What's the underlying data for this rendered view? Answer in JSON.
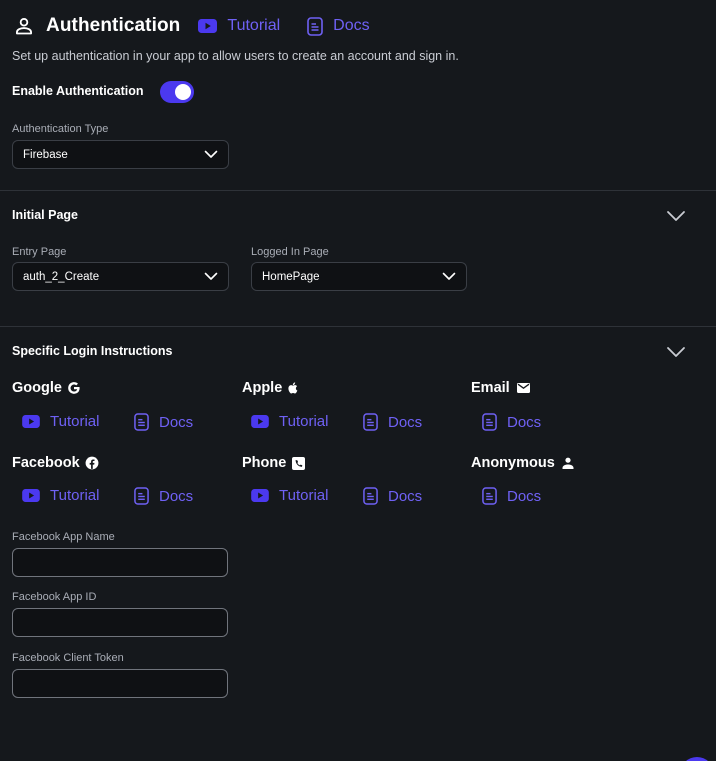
{
  "header": {
    "title": "Authentication",
    "tutorial_label": "Tutorial",
    "docs_label": "Docs",
    "subtitle": "Set up authentication in your app to allow users to create an account and sign in."
  },
  "enable": {
    "label": "Enable Authentication",
    "value": true
  },
  "auth_type": {
    "label": "Authentication Type",
    "value": "Firebase"
  },
  "initial_page": {
    "title": "Initial Page",
    "entry_label": "Entry Page",
    "entry_value": "auth_2_Create",
    "logged_in_label": "Logged In Page",
    "logged_in_value": "HomePage"
  },
  "login_instructions": {
    "title": "Specific Login Instructions",
    "providers": [
      {
        "name": "Google",
        "icon": "google-icon",
        "tutorial": "Tutorial",
        "docs": "Docs"
      },
      {
        "name": "Apple",
        "icon": "apple-icon",
        "tutorial": "Tutorial",
        "docs": "Docs"
      },
      {
        "name": "Email",
        "icon": "mail-icon",
        "docs": "Docs"
      },
      {
        "name": "Facebook",
        "icon": "facebook-icon",
        "tutorial": "Tutorial",
        "docs": "Docs"
      },
      {
        "name": "Phone",
        "icon": "phone-icon",
        "tutorial": "Tutorial",
        "docs": "Docs"
      },
      {
        "name": "Anonymous",
        "icon": "person-icon",
        "docs": "Docs"
      }
    ]
  },
  "facebook_fields": {
    "app_name_label": "Facebook App Name",
    "app_name_value": "",
    "app_id_label": "Facebook App ID",
    "app_id_value": "",
    "client_token_label": "Facebook Client Token",
    "client_token_value": ""
  },
  "colors": {
    "background": "#15181c",
    "accent": "#4b39ef",
    "link": "#6f61f4",
    "divider": "#2e3238"
  }
}
